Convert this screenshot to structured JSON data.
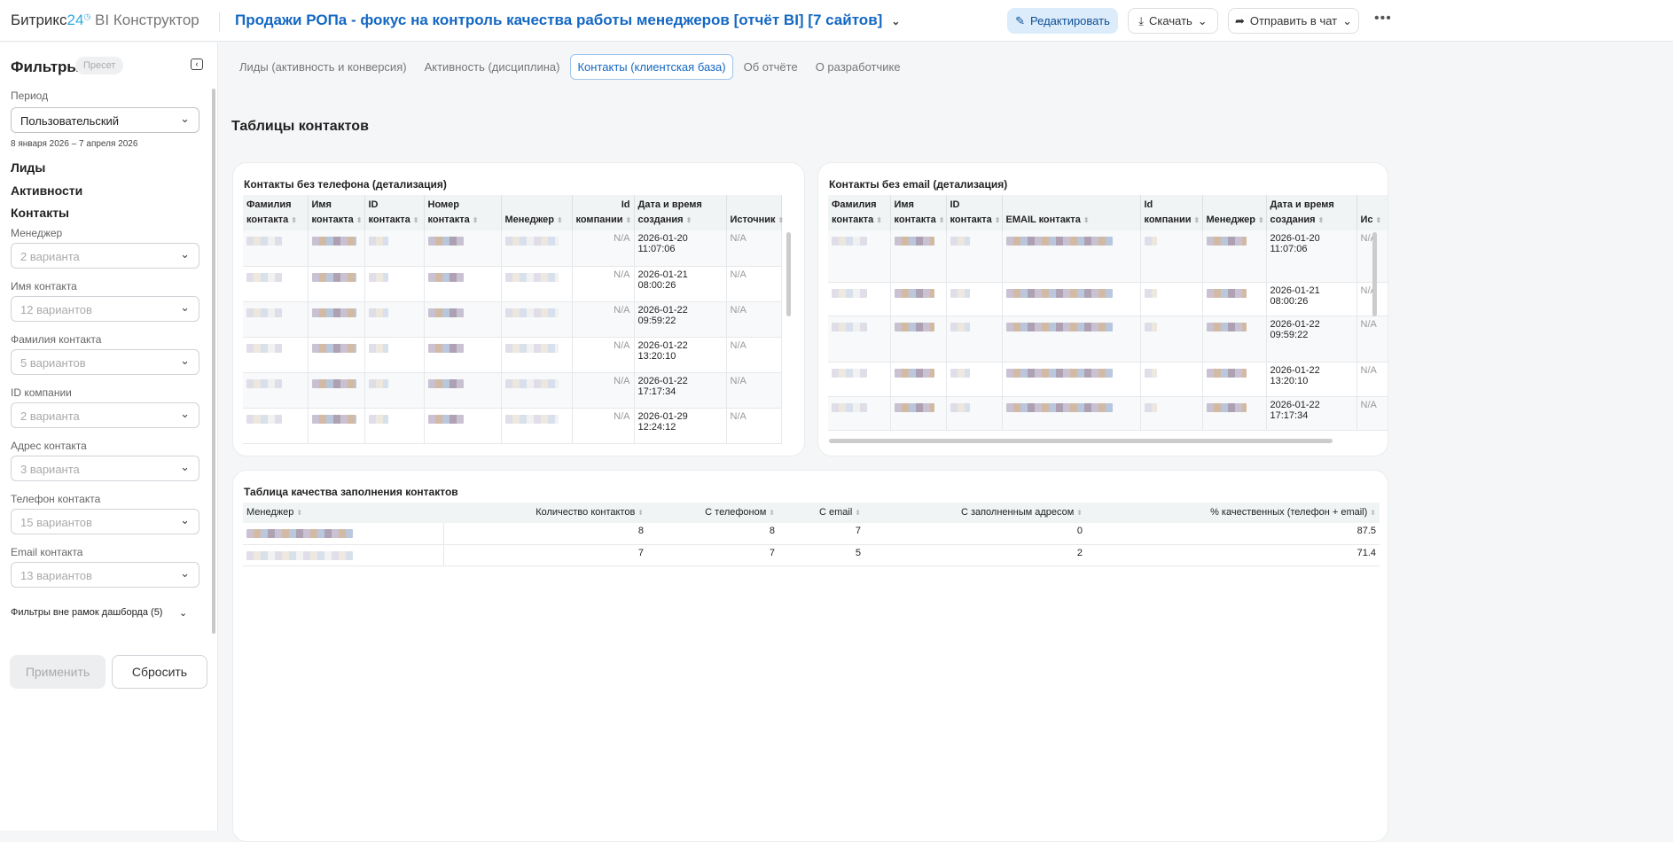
{
  "header": {
    "logo_brand": "Битрикс",
    "logo_num": "24",
    "logo_suffix": "BI Конструктор",
    "title": "Продажи РОПа - фокус на контроль качества работы менеджеров [отчёт BI] [7 сайтов]",
    "edit": "Редактировать",
    "download": "Скачать",
    "send": "Отправить в чат"
  },
  "sidebar": {
    "title": "Фильтры",
    "preset": "Пресет",
    "period_label": "Период",
    "period_value": "Пользовательский",
    "period_range": "8 января 2026 – 7 апреля 2026",
    "sections": [
      "Лиды",
      "Активности",
      "Контакты"
    ],
    "filters": [
      {
        "label": "Менеджер",
        "value": "2 варианта"
      },
      {
        "label": "Имя контакта",
        "value": "12 вариантов"
      },
      {
        "label": "Фамилия контакта",
        "value": "5 вариантов"
      },
      {
        "label": "ID компании",
        "value": "2 варианта"
      },
      {
        "label": "Адрес контакта",
        "value": "3 варианта"
      },
      {
        "label": "Телефон контакта",
        "value": "15 вариантов"
      },
      {
        "label": "Email контакта",
        "value": "13 вариантов"
      }
    ],
    "outside": "Фильтры вне рамок дашборда (5)",
    "apply": "Применить",
    "reset": "Сбросить"
  },
  "tabs": [
    "Лиды (активность и конверсия)",
    "Активность (дисциплина)",
    "Контакты (клиентская база)",
    "Об отчёте",
    "О разработчике"
  ],
  "heading": "Таблицы контактов",
  "t1": {
    "title": "Контакты без телефона (детализация)",
    "headers": [
      [
        "Фамилия",
        "контакта"
      ],
      [
        "Имя",
        "контакта"
      ],
      [
        "ID",
        "контакта"
      ],
      [
        "Номер",
        "контакта"
      ],
      [
        "",
        "Менеджер"
      ],
      [
        "Id",
        "компании"
      ],
      [
        "Дата и время",
        "создания"
      ],
      [
        "",
        "Источник"
      ]
    ],
    "rows": [
      {
        "company": "N/A",
        "date": "2026-01-20 11:07:06",
        "source": "N/A"
      },
      {
        "company": "N/A",
        "date": "2026-01-21 08:00:26",
        "source": "N/A"
      },
      {
        "company": "N/A",
        "date": "2026-01-22 09:59:22",
        "source": "N/A"
      },
      {
        "company": "N/A",
        "date": "2026-01-22 13:20:10",
        "source": "N/A"
      },
      {
        "company": "N/A",
        "date": "2026-01-22 17:17:34",
        "source": "N/A"
      },
      {
        "company": "N/A",
        "date": "2026-01-29 12:24:12",
        "source": "N/A"
      }
    ]
  },
  "t2": {
    "title": "Контакты без email (детализация)",
    "headers": [
      [
        "Фамилия",
        "контакта"
      ],
      [
        "Имя",
        "контакта"
      ],
      [
        "ID",
        "контакта"
      ],
      [
        "",
        "EMAIL контакта"
      ],
      [
        "Id",
        "компании"
      ],
      [
        "",
        "Менеджер"
      ],
      [
        "Дата и время",
        "создания"
      ],
      [
        "",
        "Ис"
      ]
    ],
    "rows": [
      {
        "date": "2026-01-20 11:07:06",
        "source": "N/A"
      },
      {
        "date": "2026-01-21 08:00:26",
        "source": "N/A"
      },
      {
        "date": "2026-01-22 09:59:22",
        "source": "N/A"
      },
      {
        "date": "2026-01-22 13:20:10",
        "source": "N/A"
      },
      {
        "date": "2026-01-22 17:17:34",
        "source": "N/A"
      }
    ]
  },
  "t3": {
    "title": "Таблица качества заполнения контактов",
    "headers": [
      "Менеджер",
      "Количество контактов",
      "С телефоном",
      "С email",
      "С заполненным адресом",
      "% качественных (телефон + email)"
    ],
    "rows": [
      [
        "8",
        "8",
        "7",
        "0",
        "87.5"
      ],
      [
        "7",
        "7",
        "5",
        "2",
        "71.4"
      ]
    ]
  }
}
